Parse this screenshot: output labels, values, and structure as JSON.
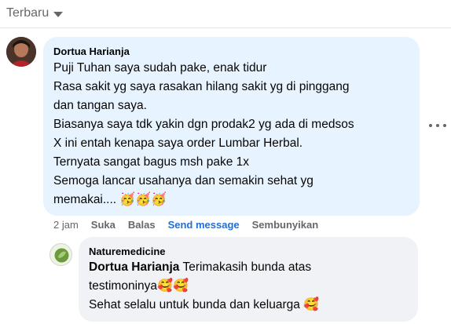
{
  "sort": {
    "label": "Terbaru"
  },
  "comment": {
    "author": "Dortua Harianja",
    "lines": [
      "Puji Tuhan saya sudah pake, enak tidur",
      "Rasa sakit yg saya rasakan hilang sakit yg di pinggang",
      "dan tangan saya.",
      "Biasanya saya tdk yakin dgn prodak2 yg ada di medsos",
      "X ini entah kenapa saya order Lumbar Herbal.",
      "Ternyata sangat bagus msh pake 1x",
      "Semoga lancar usahanya dan semakin sehat yg"
    ],
    "last_line": "memakai....",
    "last_line_emojis": "🥳🥳🥳",
    "timestamp": "2 jam",
    "actions": {
      "like": "Suka",
      "reply": "Balas",
      "send_message": "Send message",
      "hide": "Sembunyikan"
    }
  },
  "reply": {
    "author": "Naturemedicine",
    "mention": "Dortua Harianja",
    "line1_rest": " Terimakasih bunda atas",
    "line2": "testimoninya",
    "line2_emojis": "🥰🥰",
    "line3": "Sehat selalu untuk bunda dan keluarga",
    "line3_emoji": "🥰"
  },
  "colors": {
    "main_bubble": "#e7f3ff",
    "reply_bubble": "#f0f2f5",
    "link_blue": "#216fdb",
    "secondary_text": "#65676b"
  }
}
